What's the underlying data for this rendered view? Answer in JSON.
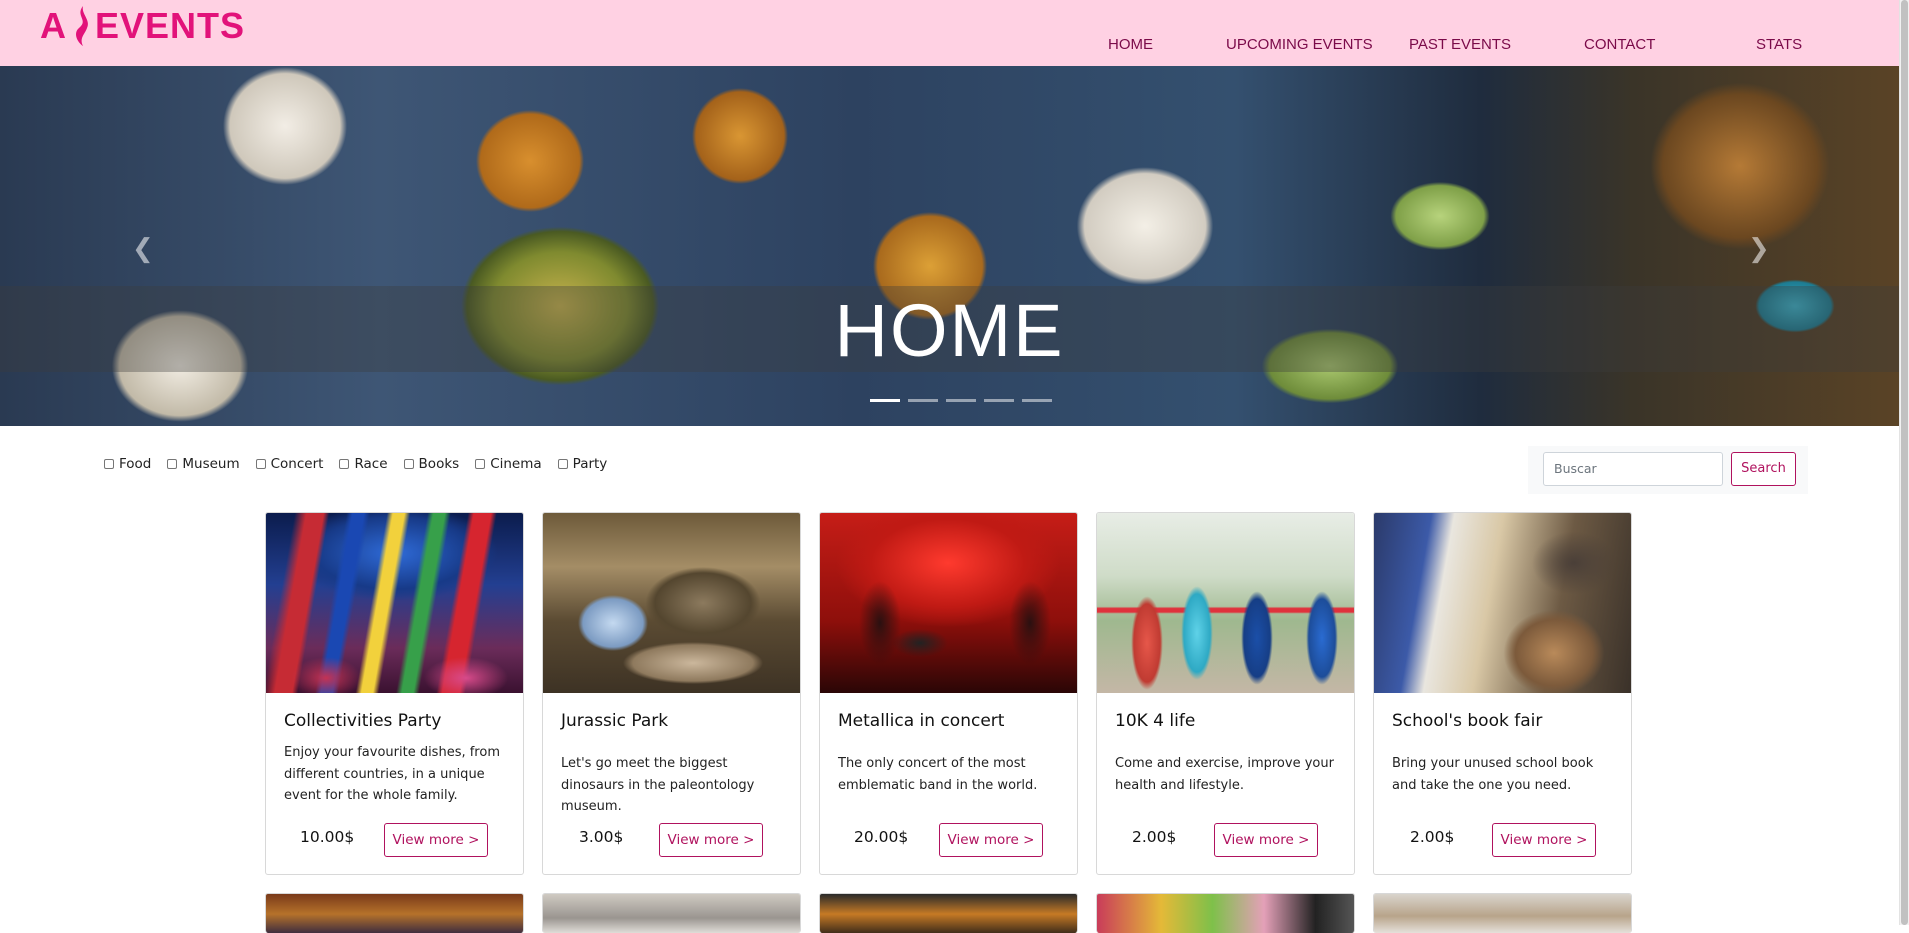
{
  "brand": {
    "logo_text_left": "A",
    "logo_text_right": "EVENTS",
    "accent": "#e2127a"
  },
  "nav": {
    "items": [
      {
        "label": "HOME"
      },
      {
        "label": "UPCOMING EVENTS"
      },
      {
        "label": "PAST EVENTS"
      },
      {
        "label": "CONTACT"
      },
      {
        "label": "STATS"
      }
    ]
  },
  "hero": {
    "title": "HOME",
    "prev_icon": "chevron-left-icon",
    "next_icon": "chevron-right-icon",
    "indicator_count": 5,
    "active_indicator": 1
  },
  "filters": {
    "categories": [
      {
        "label": "Food",
        "checked": false
      },
      {
        "label": "Museum",
        "checked": false
      },
      {
        "label": "Concert",
        "checked": false
      },
      {
        "label": "Race",
        "checked": false
      },
      {
        "label": "Books",
        "checked": false
      },
      {
        "label": "Cinema",
        "checked": false
      },
      {
        "label": "Party",
        "checked": false
      }
    ]
  },
  "search": {
    "placeholder": "Buscar",
    "button_label": "Search"
  },
  "events": [
    {
      "title": "Collectivities Party",
      "description": "Enjoy your favourite dishes, from different countries, in a unique event for the whole family.",
      "price": "10.00$",
      "more_label": "View more >"
    },
    {
      "title": "Jurassic Park",
      "description": "Let's go meet the biggest dinosaurs in the paleontology museum.",
      "price": "3.00$",
      "more_label": "View more >"
    },
    {
      "title": "Metallica in concert",
      "description": "The only concert of the most emblematic band in the world.",
      "price": "20.00$",
      "more_label": "View more >"
    },
    {
      "title": "10K 4 life",
      "description": "Come and exercise, improve your health and lifestyle.",
      "price": "2.00$",
      "more_label": "View more >"
    },
    {
      "title": "School's book fair",
      "description": "Bring your unused school book and take the one you need.",
      "price": "2.00$",
      "more_label": "View more >"
    }
  ]
}
